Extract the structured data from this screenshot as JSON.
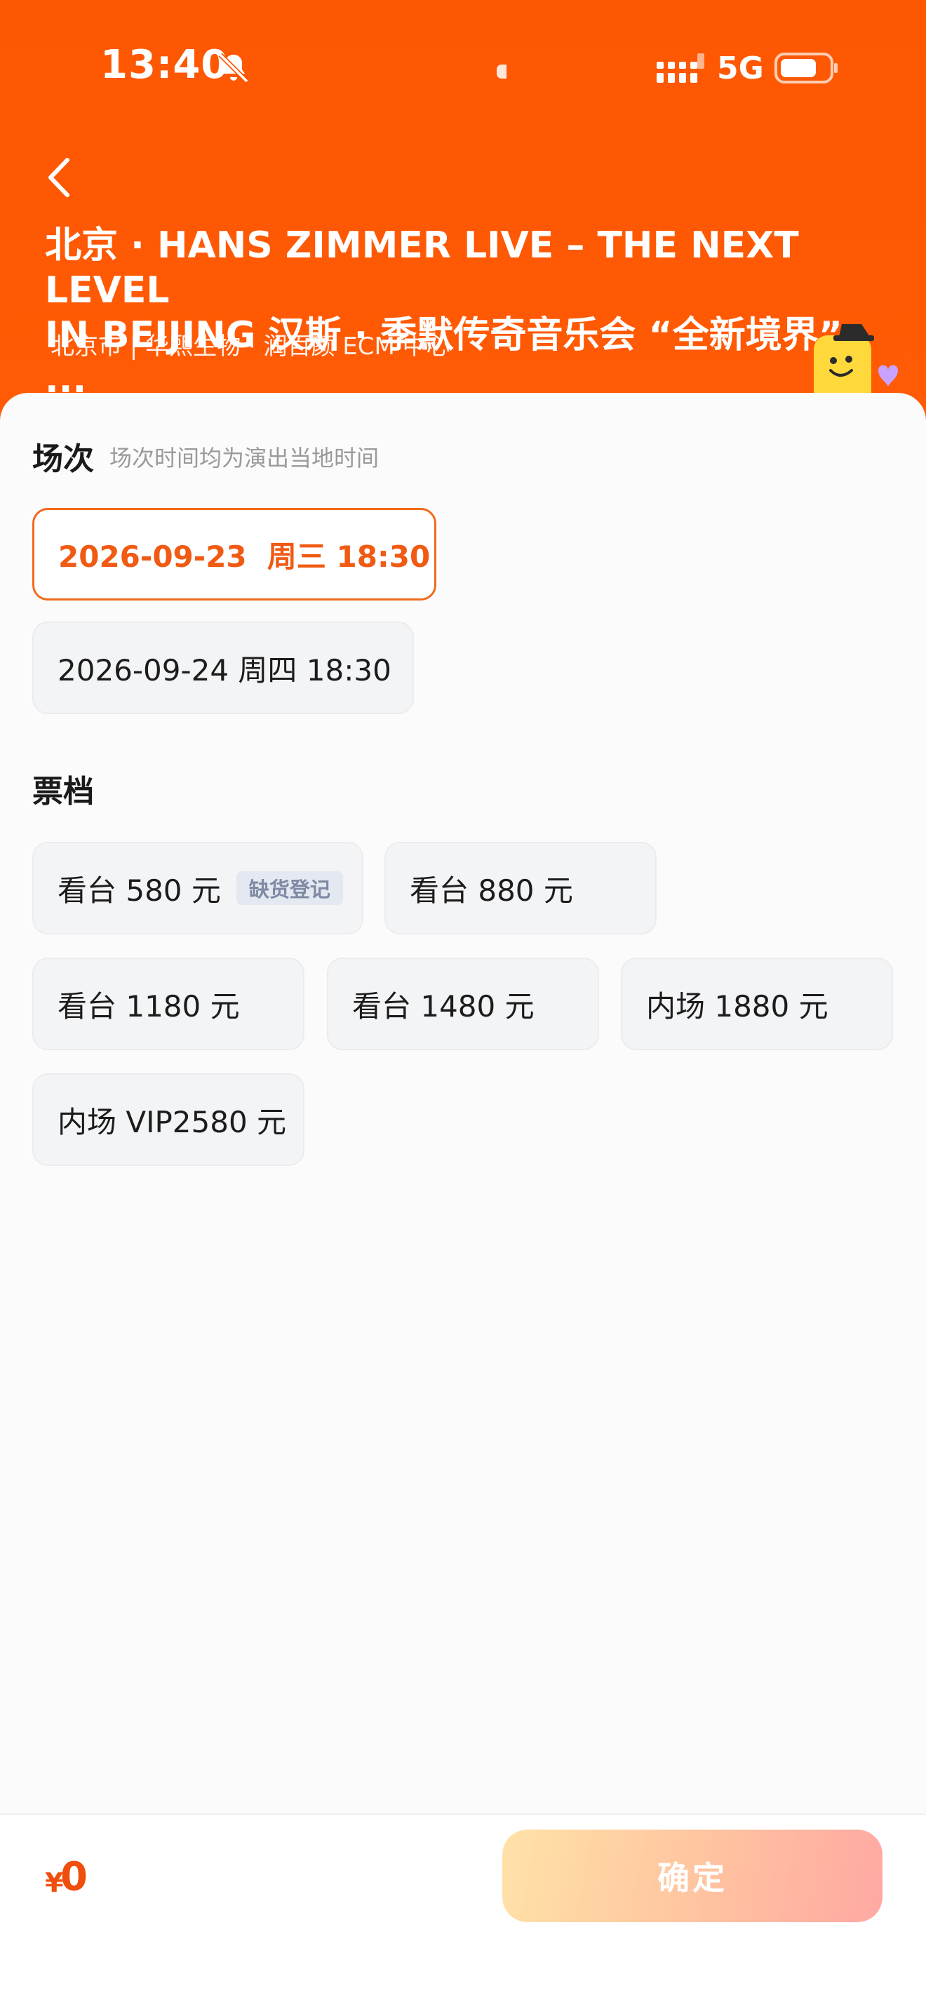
{
  "status_bar": {
    "time": "13:40",
    "network": "5G",
    "icons": [
      "bell-muted-icon",
      "signal-icon",
      "battery-icon"
    ]
  },
  "header": {
    "back_icon": "chevron-left-icon",
    "title": "北京 · HANS ZIMMER LIVE – THE NEXT LEVEL\nIN BEIJING 汉斯 · 季默传奇音乐会 “全新境界” ...",
    "venue": "北京市 | 华熙生物 · 润百颜 ECM 中心",
    "background_color": "#fe5703"
  },
  "sessions": {
    "title": "场次",
    "hint": "场次时间均为演出当地时间",
    "options": [
      {
        "label": "2026-09-23  周三 18:30",
        "selected": true
      },
      {
        "label": "2026-09-24 周四 18:30",
        "selected": false
      }
    ]
  },
  "tickets": {
    "title": "票档",
    "options": [
      {
        "label": "看台 580 元",
        "tag": "缺货登记"
      },
      {
        "label": "看台 880 元"
      },
      {
        "label": "看台 1180 元"
      },
      {
        "label": "看台 1480 元"
      },
      {
        "label": "内场 1880 元"
      },
      {
        "label": "内场 VIP2580 元"
      }
    ]
  },
  "footer": {
    "currency": "¥",
    "price": "0",
    "confirm_label": "确定",
    "accent_color": "#f04e0c"
  }
}
